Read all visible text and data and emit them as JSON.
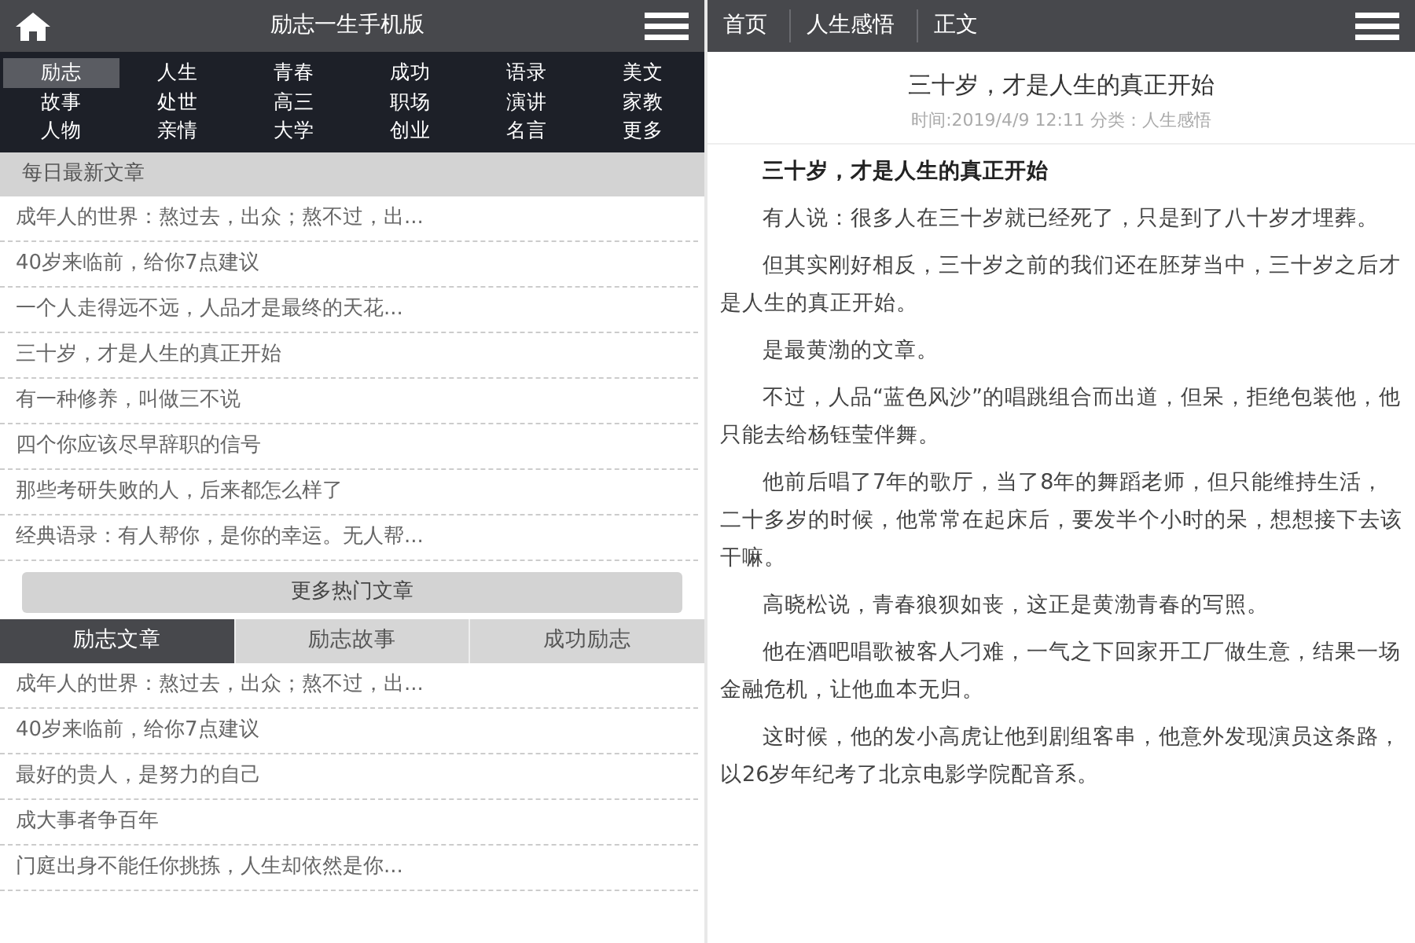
{
  "left": {
    "header": {
      "title": "励志一生手机版"
    },
    "categories": [
      {
        "label": "励志",
        "selected": true
      },
      {
        "label": "人生",
        "selected": false
      },
      {
        "label": "青春",
        "selected": false
      },
      {
        "label": "成功",
        "selected": false
      },
      {
        "label": "语录",
        "selected": false
      },
      {
        "label": "美文",
        "selected": false
      },
      {
        "label": "故事",
        "selected": false
      },
      {
        "label": "处世",
        "selected": false
      },
      {
        "label": "高三",
        "selected": false
      },
      {
        "label": "职场",
        "selected": false
      },
      {
        "label": "演讲",
        "selected": false
      },
      {
        "label": "家教",
        "selected": false
      },
      {
        "label": "人物",
        "selected": false
      },
      {
        "label": "亲情",
        "selected": false
      },
      {
        "label": "大学",
        "selected": false
      },
      {
        "label": "创业",
        "selected": false
      },
      {
        "label": "名言",
        "selected": false
      },
      {
        "label": "更多",
        "selected": false
      }
    ],
    "latest": {
      "heading": "每日最新文章",
      "items": [
        "成年人的世界：熬过去，出众；熬不过，出...",
        "40岁来临前，给你7点建议",
        "一个人走得远不远，人品才是最终的天花...",
        "三十岁，才是人生的真正开始",
        "有一种修养，叫做三不说",
        "四个你应该尽早辞职的信号",
        "那些考研失败的人，后来都怎么样了",
        "经典语录：有人帮你，是你的幸运。无人帮..."
      ],
      "more_button": "更多热门文章"
    },
    "tabs": [
      {
        "label": "励志文章",
        "selected": true
      },
      {
        "label": "励志故事",
        "selected": false
      },
      {
        "label": "成功励志",
        "selected": false
      }
    ],
    "tab_items": [
      "成年人的世界：熬过去，出众；熬不过，出...",
      "40岁来临前，给你7点建议",
      "最好的贵人，是努力的自己",
      "成大事者争百年",
      "门庭出身不能任你挑拣，人生却依然是你..."
    ]
  },
  "right": {
    "breadcrumb": [
      "首页",
      "人生感悟",
      "正文"
    ],
    "article": {
      "title": "三十岁，才是人生的真正开始",
      "meta": "时间:2019/4/9 12:11 分类：人生感悟",
      "paragraphs": [
        {
          "kind": "heading",
          "text": "三十岁，才是人生的真正开始"
        },
        {
          "kind": "text",
          "text": "有人说：很多人在三十岁就已经死了，只是到了八十岁才埋葬。"
        },
        {
          "kind": "text",
          "text": "但其实刚好相反，三十岁之前的我们还在胚芽当中，三十岁之后才是人生的真正开始。"
        },
        {
          "kind": "text",
          "text": "是最黄渤的文章。"
        },
        {
          "kind": "text",
          "text": "不过，人品“蓝色风沙”的唱跳组合而出道，但呆，拒绝包装他，他只能去给杨钰莹伴舞。"
        },
        {
          "kind": "text",
          "text": "他前后唱了7年的歌厅，当了8年的舞蹈老师，但只能维持生活，二十多岁的时候，他常常在起床后，要发半个小时的呆，想想接下去该干嘛。"
        },
        {
          "kind": "text",
          "text": "高晓松说，青春狼狈如丧，这正是黄渤青春的写照。"
        },
        {
          "kind": "text",
          "text": "他在酒吧唱歌被客人刁难，一气之下回家开工厂做生意，结果一场金融危机，让他血本无归。"
        },
        {
          "kind": "text",
          "text": "这时候，他的发小高虎让他到剧组客串，他意外发现演员这条路，以26岁年纪考了北京电影学院配音系。"
        }
      ]
    }
  }
}
